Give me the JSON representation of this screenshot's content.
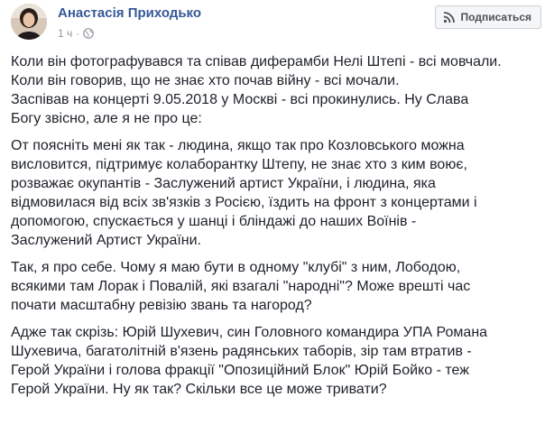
{
  "post": {
    "author": "Анастасія Приходько",
    "timestamp": "1 ч",
    "privacy_icon": "globe-icon",
    "subscribe_icon": "rss-icon",
    "subscribe_label": "Подписаться",
    "paragraphs": [
      [
        "Коли він фотографувався та співав диферамби Нелі Штепі - всі мовчали.",
        "Коли він говорив, що не знає хто почав війну - всі мочали.",
        "Заспівав на концерті 9.05.2018 у Москві - всі прокинулись. Ну Слава",
        "Богу звісно, але я не про це:"
      ],
      [
        "От поясніть мені як так - людина, якщо так про Козловського можна",
        "висловится, підтримує колаборантку Штепу, не знає хто з ким воює,",
        "розважає окупантів - Заслужений артист України, і людина, яка",
        "відмовилася від всіх зв'язків з Росією, їздить на фронт з концертами і",
        "допомогою, спускається у шанці і бліндажі до наших Воїнів -",
        "Заслужений Артист України."
      ],
      [
        "Так, я про себе. Чому я маю бути в одному \"клубі\" з ним, Лободою,",
        "всякими там Лорак і Повалій, які взагалі \"народні\"? Може врешті час",
        "почати масштабну ревізію звань та нагород?"
      ],
      [
        "Адже так скрізь: Юрій Шухевич, син Головного командира УПА Романа",
        "Шухевича, багатолітній в'язень радянських таборів, зір там втратив -",
        "Герой України і голова фракції \"Опозиційний Блок\" Юрій Бойко - теж",
        "Герой України. Ну як так? Скільки все це може тривати?"
      ]
    ]
  }
}
